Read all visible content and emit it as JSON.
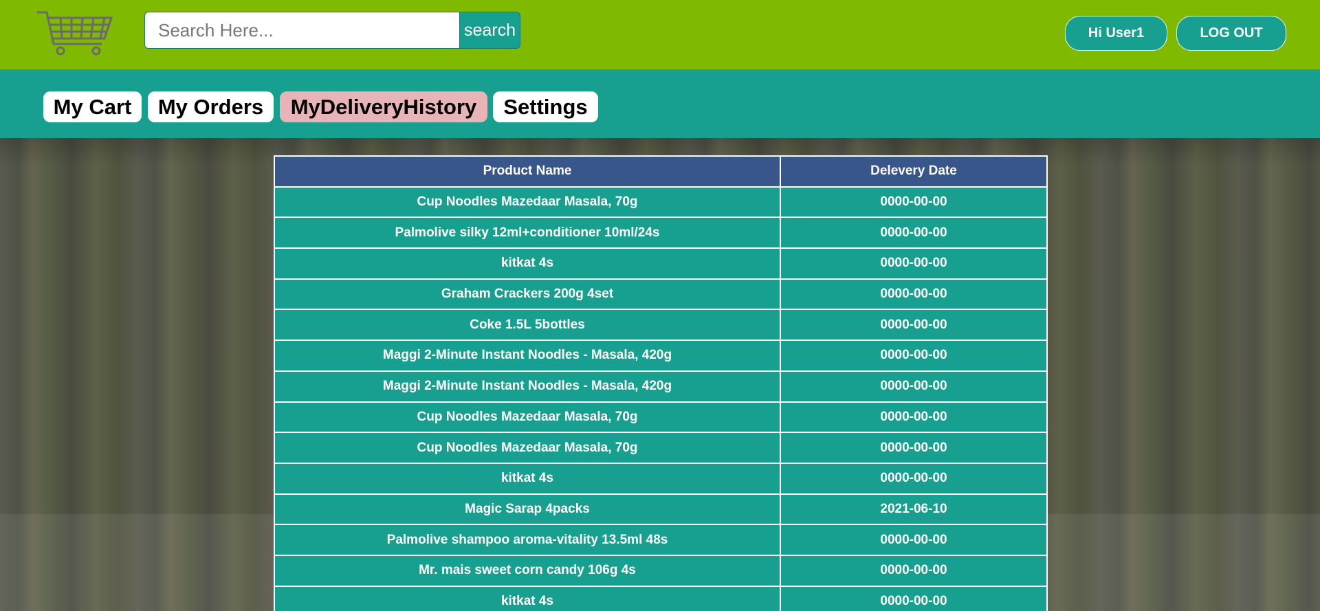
{
  "header": {
    "logo_icon": "shopping-cart-icon",
    "search": {
      "placeholder": "Search Here...",
      "value": "",
      "button_label": "search"
    },
    "user_label": "Hi User1",
    "logout_label": "LOG OUT"
  },
  "nav": {
    "tabs": [
      {
        "label": "My Cart",
        "active": false
      },
      {
        "label": "My Orders",
        "active": false
      },
      {
        "label": "MyDeliveryHistory",
        "active": true
      },
      {
        "label": "Settings",
        "active": false
      }
    ]
  },
  "table": {
    "columns": [
      "Product Name",
      "Delevery Date"
    ],
    "rows": [
      [
        "Cup Noodles Mazedaar Masala, 70g",
        "0000-00-00"
      ],
      [
        "Palmolive silky 12ml+conditioner 10ml/24s",
        "0000-00-00"
      ],
      [
        "kitkat 4s",
        "0000-00-00"
      ],
      [
        "Graham Crackers 200g 4set",
        "0000-00-00"
      ],
      [
        "Coke 1.5L 5bottles",
        "0000-00-00"
      ],
      [
        "Maggi 2-Minute Instant Noodles - Masala, 420g",
        "0000-00-00"
      ],
      [
        "Maggi 2-Minute Instant Noodles - Masala, 420g",
        "0000-00-00"
      ],
      [
        "Cup Noodles Mazedaar Masala, 70g",
        "0000-00-00"
      ],
      [
        "Cup Noodles Mazedaar Masala, 70g",
        "0000-00-00"
      ],
      [
        "kitkat 4s",
        "0000-00-00"
      ],
      [
        "Magic Sarap 4packs",
        "2021-06-10"
      ],
      [
        "Palmolive shampoo aroma-vitality 13.5ml 48s",
        "0000-00-00"
      ],
      [
        "Mr. mais sweet corn candy 106g 4s",
        "0000-00-00"
      ],
      [
        "kitkat 4s",
        "0000-00-00"
      ]
    ]
  },
  "colors": {
    "topbar": "#7fba00",
    "teal": "#17a08f",
    "table_header": "#38568a",
    "active_tab": "#e8b4b8"
  }
}
